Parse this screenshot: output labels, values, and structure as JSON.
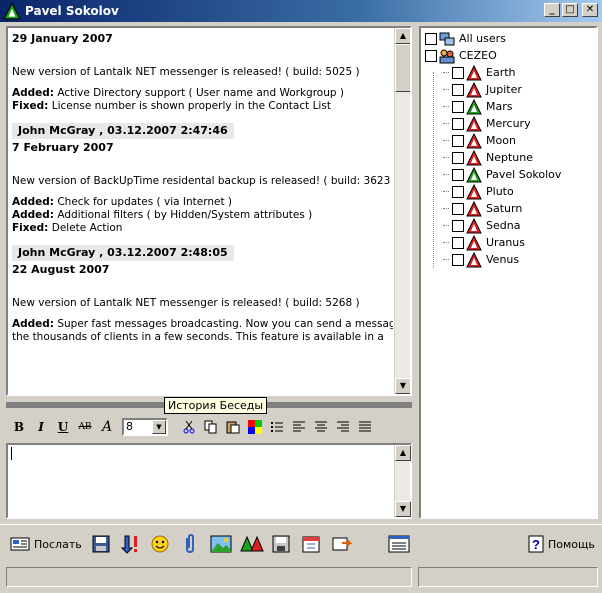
{
  "window": {
    "title": "Pavel Sokolov"
  },
  "messages": [
    {
      "date": "29 January 2007",
      "text": "New version of Lantalk NET messenger is released! ( build: 5025 )",
      "items": [
        {
          "tag": "Added:",
          "text": " Active Directory support ( User name and Workgroup )"
        },
        {
          "tag": "Fixed:",
          "text": " License number is shown properly in the Contact List"
        }
      ]
    },
    {
      "header": "John McGray , 03.12.2007 2:47:46",
      "date": "7 February 2007",
      "text": "New version of BackUpTime residental backup is released! ( build: 3623 )",
      "items": [
        {
          "tag": "Added:",
          "text": " Check for updates ( via Internet )"
        },
        {
          "tag": "Added:",
          "text": " Additional filters ( by Hidden/System attributes )"
        },
        {
          "tag": "Fixed:",
          "text": " Delete Action"
        }
      ]
    },
    {
      "header": "John McGray , 03.12.2007 2:48:05",
      "date": "22 August 2007",
      "text": "New version of Lantalk NET messenger is released! ( build: 5268 )",
      "items": [
        {
          "tag": "Added:",
          "text": " Super fast messages broadcasting. Now you can send a message to"
        },
        {
          "tag": "",
          "text": "the thousands of clients in a few seconds. This feature is available in a"
        }
      ]
    }
  ],
  "tooltip": "История Беседы",
  "format": {
    "bold": "B",
    "italic": "I",
    "underline": "U",
    "strike": "AB",
    "font": "A",
    "font_size": "8"
  },
  "users": {
    "all_users": "All users",
    "group": "CEZEO",
    "members": [
      {
        "name": "Earth",
        "status": "red"
      },
      {
        "name": "Jupiter",
        "status": "red"
      },
      {
        "name": "Mars",
        "status": "green"
      },
      {
        "name": "Mercury",
        "status": "red"
      },
      {
        "name": "Moon",
        "status": "red"
      },
      {
        "name": "Neptune",
        "status": "red"
      },
      {
        "name": "Pavel Sokolov",
        "status": "green"
      },
      {
        "name": "Pluto",
        "status": "red"
      },
      {
        "name": "Saturn",
        "status": "red"
      },
      {
        "name": "Sedna",
        "status": "red"
      },
      {
        "name": "Uranus",
        "status": "red"
      },
      {
        "name": "Venus",
        "status": "red"
      }
    ]
  },
  "bottom": {
    "send": "Послать",
    "help": "Помощь"
  },
  "colors": {
    "title_bg": "#0a246a",
    "panel_bg": "#d4d0c8",
    "status_red": "#e02020",
    "status_green": "#20a020"
  }
}
